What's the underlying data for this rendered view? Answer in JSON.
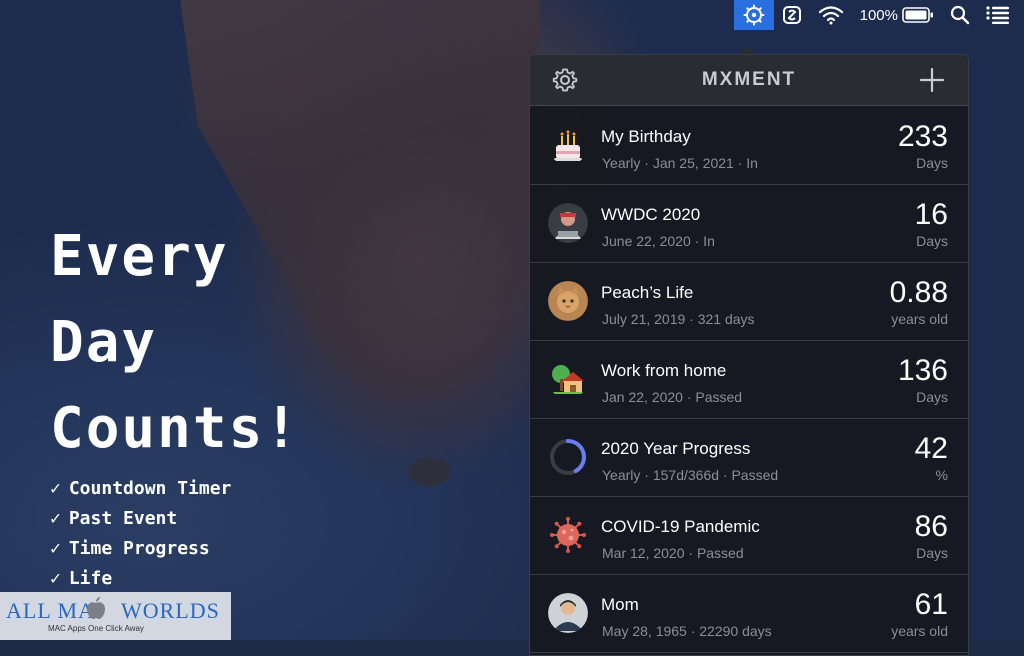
{
  "menubar": {
    "items": [
      {
        "name": "moment-app-icon",
        "active": true
      },
      {
        "name": "script-editor-icon"
      },
      {
        "name": "wifi-icon"
      },
      {
        "name": "battery-percent",
        "label": "100%"
      },
      {
        "name": "battery-icon"
      },
      {
        "name": "spotlight-search-icon"
      },
      {
        "name": "notification-center-icon"
      }
    ],
    "battery_label": "100%",
    "active_color": "#2a6fe0"
  },
  "hero": {
    "headline": [
      "Every",
      "Day",
      "Counts!"
    ],
    "features": [
      "Countdown Timer",
      "Past Event",
      "Time Progress",
      "Life"
    ],
    "check_glyph": "✓"
  },
  "watermark": {
    "title_before": "ALL MA",
    "title_after": " WORLDS",
    "subtitle": "MAC Apps One Click Away",
    "color": "#2b66c0"
  },
  "panel": {
    "app_title": "MXMENT",
    "settings_icon": "gear-icon",
    "add_icon": "plus-icon",
    "events": [
      {
        "title": "My Birthday",
        "subtitle": "Yearly · Jan 25, 2021 · In",
        "value": "233",
        "unit": "Days",
        "icon": "birthday-cake-icon"
      },
      {
        "title": "WWDC 2020",
        "subtitle": "June 22, 2020 · In",
        "value": "16",
        "unit": "Days",
        "icon": "wwdc-avatar-icon"
      },
      {
        "title": "Peach’s Life",
        "subtitle": "July 21, 2019 · 321 days",
        "value": "0.88",
        "unit": "years old",
        "icon": "cat-photo-icon"
      },
      {
        "title": "Work from home",
        "subtitle": "Jan 22, 2020 · Passed",
        "value": "136",
        "unit": "Days",
        "icon": "house-icon"
      },
      {
        "title": "2020 Year Progress",
        "subtitle": "Yearly · 157d/366d · Passed",
        "value": "42",
        "unit": "%",
        "icon": "progress-ring-icon",
        "progress": 0.42
      },
      {
        "title": "COVID-19 Pandemic",
        "subtitle": "Mar 12, 2020 · Passed",
        "value": "86",
        "unit": "Days",
        "icon": "virus-icon"
      },
      {
        "title": "Mom",
        "subtitle": "May 28, 1965 · 22290 days",
        "value": "61",
        "unit": "years old",
        "icon": "person-photo-icon"
      }
    ]
  }
}
